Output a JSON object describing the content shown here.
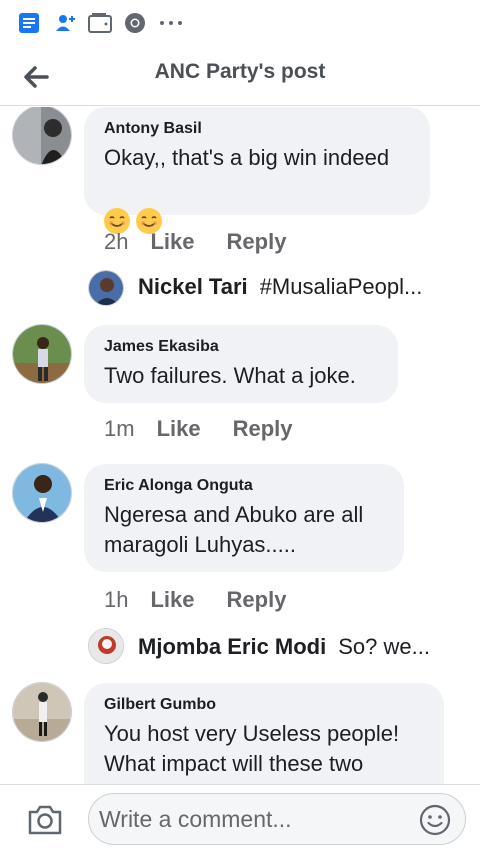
{
  "header": {
    "title": "ANC Party's post"
  },
  "comments": [
    {
      "author": "Antony Basil",
      "text": "Okay,, that's a big win indeed",
      "time": "2h",
      "like": "Like",
      "reply": "Reply"
    },
    {
      "author": "James Ekasiba",
      "text": "Two failures. What a joke.",
      "time": "1m",
      "like": "Like",
      "reply": "Reply"
    },
    {
      "author": "Eric Alonga Onguta",
      "text": "Ngeresa and Abuko are all\nmaragoli Luhyas.....",
      "time": "1h",
      "like": "Like",
      "reply": "Reply"
    },
    {
      "author": "Gilbert Gumbo",
      "text": "You host very Useless people!\nWhat impact will these two"
    }
  ],
  "replies": [
    {
      "name": "Nickel Tari",
      "text": "#MusaliaPeopl..."
    },
    {
      "name": "Mjomba Eric Modi",
      "text": "So? we..."
    }
  ],
  "composer": {
    "placeholder": "Write a comment..."
  },
  "colors": {
    "accent": "#1877f2",
    "bubble": "#f0f2f5",
    "meta": "#65676b"
  }
}
